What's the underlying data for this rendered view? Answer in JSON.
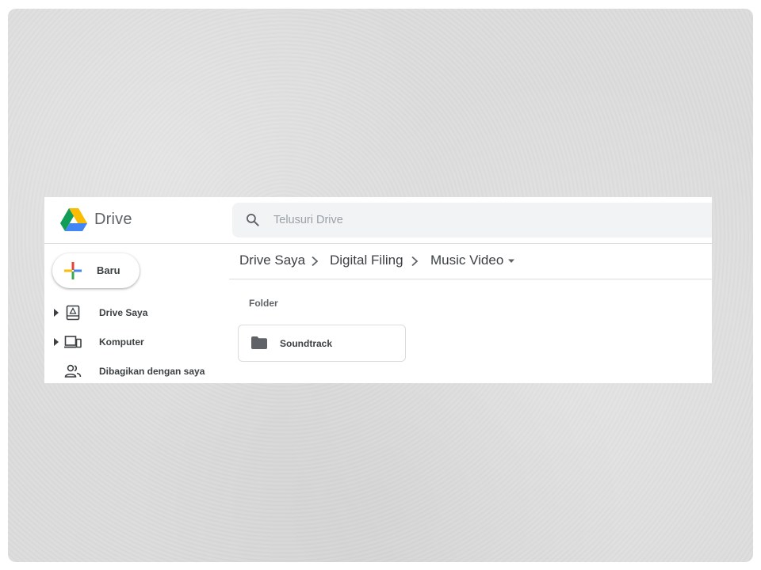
{
  "app": {
    "product_name": "Drive"
  },
  "search": {
    "placeholder": "Telusuri Drive",
    "value": ""
  },
  "new_button": {
    "label": "Baru"
  },
  "sidebar": {
    "items": [
      {
        "label": "Drive Saya",
        "icon": "my-drive-icon",
        "expandable": true
      },
      {
        "label": "Komputer",
        "icon": "computers-icon",
        "expandable": true
      },
      {
        "label": "Dibagikan dengan saya",
        "icon": "shared-with-me-icon",
        "expandable": false
      }
    ]
  },
  "breadcrumb": {
    "items": [
      "Drive Saya",
      "Digital Filing",
      "Music Video"
    ]
  },
  "content": {
    "section_label": "Folder",
    "folders": [
      {
        "name": "Soundtrack"
      }
    ]
  },
  "colors": {
    "google_blue": "#4285f4",
    "google_red": "#ea4335",
    "google_yellow": "#fbbc04",
    "google_green": "#34a853",
    "drive_blue": "#4285f4",
    "drive_green": "#0f9d58",
    "drive_yellow": "#fbbc04",
    "text_primary": "#3c4043",
    "text_secondary": "#5f6368",
    "search_bg": "#f1f3f4",
    "divider": "#dadce0"
  }
}
